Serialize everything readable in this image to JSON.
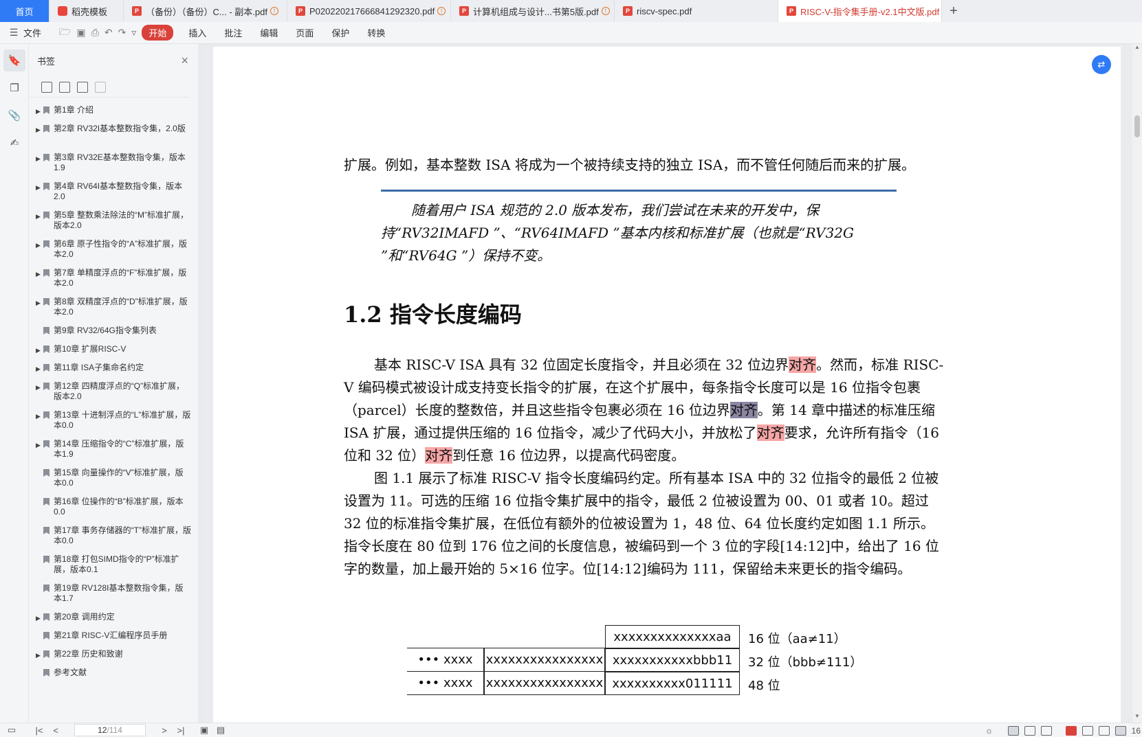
{
  "tabs": [
    {
      "label": "首页",
      "type": "home"
    },
    {
      "label": "稻壳模板",
      "type": "docer"
    },
    {
      "label": "（备份）（备份）C... - 副本.pdf",
      "type": "pdf",
      "warn": true
    },
    {
      "label": "P020220217666841292320.pdf",
      "type": "pdf",
      "warn": true
    },
    {
      "label": "计算机组成与设计...书第5版.pdf",
      "type": "pdf",
      "warn": true
    },
    {
      "label": "riscv-spec.pdf",
      "type": "pdf",
      "warn": false
    },
    {
      "label": "RISC-V-指令集手册-v2.1中文版.pdf",
      "type": "pdf",
      "active": true
    }
  ],
  "toolbar": {
    "file_label": "文件",
    "start_label": "开始",
    "menus": [
      "插入",
      "批注",
      "编辑",
      "页面",
      "保护",
      "转换"
    ]
  },
  "panel": {
    "title": "书签",
    "bookmarks": [
      {
        "label": "第1章 介绍",
        "expandable": true
      },
      {
        "label": "第2章 RV32I基本整数指令集，2.0版",
        "expandable": true
      },
      {
        "label": "第3章 RV32E基本整数指令集，版本1.9",
        "expandable": true
      },
      {
        "label": "第4章 RV64I基本整数指令集，版本2.0",
        "expandable": true
      },
      {
        "label": "第5章 整数乘法除法的“M”标准扩展，版本2.0",
        "expandable": true
      },
      {
        "label": "第6章 原子性指令的“A”标准扩展，版本2.0",
        "expandable": true
      },
      {
        "label": "第7章 单精度浮点的“F”标准扩展，版本2.0",
        "expandable": true
      },
      {
        "label": "第8章 双精度浮点的“D”标准扩展，版本2.0",
        "expandable": true
      },
      {
        "label": "第9章 RV32/64G指令集列表",
        "expandable": false
      },
      {
        "label": "第10章 扩展RISC-V",
        "expandable": true
      },
      {
        "label": "第11章 ISA子集命名约定",
        "expandable": true
      },
      {
        "label": "第12章 四精度浮点的“Q”标准扩展，版本2.0",
        "expandable": true
      },
      {
        "label": "第13章 十进制浮点的“L”标准扩展，版本0.0",
        "expandable": true
      },
      {
        "label": "第14章 压缩指令的“C”标准扩展，版本1.9",
        "expandable": true
      },
      {
        "label": "第15章 向量操作的“V”标准扩展，版本0.0",
        "expandable": false
      },
      {
        "label": "第16章 位操作的“B”标准扩展，版本0.0",
        "expandable": false
      },
      {
        "label": "第17章 事务存储器的“T”标准扩展，版本0.0",
        "expandable": false
      },
      {
        "label": "第18章 打包SIMD指令的“P”标准扩展，版本0.1",
        "expandable": false
      },
      {
        "label": "第19章 RV128I基本整数指令集，版本1.7",
        "expandable": false
      },
      {
        "label": "第20章 调用约定",
        "expandable": true
      },
      {
        "label": "第21章 RISC-V汇编程序员手册",
        "expandable": false
      },
      {
        "label": "第22章 历史和致谢",
        "expandable": true
      },
      {
        "label": "参考文献",
        "expandable": false
      }
    ]
  },
  "document": {
    "intro": "扩展。例如，基本整数 ISA 将成为一个被持续支持的独立 ISA，而不管任何随后而来的扩展。",
    "quote": "随着用户 ISA 规范的 2.0 版本发布，我们尝试在未来的开发中，保持“RV32IMAFD ”、“RV64IMAFD ”基本内核和标准扩展（也就是“RV32G ”和“RV64G ”）保持不变。",
    "section_title": "1.2 指令长度编码",
    "p1": [
      {
        "t": "基本 RISC-V ISA 具有 32 位固定长度指令，并且必须在 32 位边界"
      },
      {
        "t": "对齐",
        "hl": "red"
      },
      {
        "t": "。然而，标准 RISC-V 编码模式被设计成支持变长指令的扩展，在这个扩展中，每条指令长度可以是 16 位指令包裹（parcel）长度的整数倍，并且这些指令包裹必须在 16 位边界"
      },
      {
        "t": "对齐",
        "hl": "dark"
      },
      {
        "t": "。第 14 章中描述的标准压缩 ISA 扩展，通过提供压缩的 16 位指令，减少了代码大小，并放松了"
      },
      {
        "t": "对齐",
        "hl": "red"
      },
      {
        "t": "要求，允许所有指令（16 位和 32 位）"
      },
      {
        "t": "对齐",
        "hl": "red"
      },
      {
        "t": "到任意 16 位边界，以提高代码密度。"
      }
    ],
    "p2": "图 1.1 展示了标准 RISC-V 指令长度编码约定。所有基本 ISA 中的 32 位指令的最低 2 位被设置为 11。可选的压缩 16 位指令集扩展中的指令，最低 2 位被设置为 00、01 或者 10。超过 32 位的标准指令集扩展，在低位有额外的位被设置为 1，48 位、64 位长度约定如图 1.1 所示。指令长度在 80 位到 176 位之间的长度信息，被编码到一个 3 位的字段[14:12]中，给出了 16 位字的数量，加上最开始的 5×16 位字。位[14:12]编码为 111，保留给未来更长的指令编码。",
    "figure_rows": [
      {
        "cells": [
          "",
          "",
          "xxxxxxxxxxxxxxaa"
        ],
        "label": "16 位（aa≠11）"
      },
      {
        "cells": [
          "••• xxxx",
          "xxxxxxxxxxxxxxxx",
          "xxxxxxxxxxxbbb11"
        ],
        "label": "32 位（bbb≠111）"
      },
      {
        "cells": [
          "••• xxxx",
          "xxxxxxxxxxxxxxxx",
          "xxxxxxxxxx011111"
        ],
        "label": "48 位"
      }
    ]
  },
  "status": {
    "page_current": "12",
    "page_total": "114",
    "zoom": "16"
  }
}
